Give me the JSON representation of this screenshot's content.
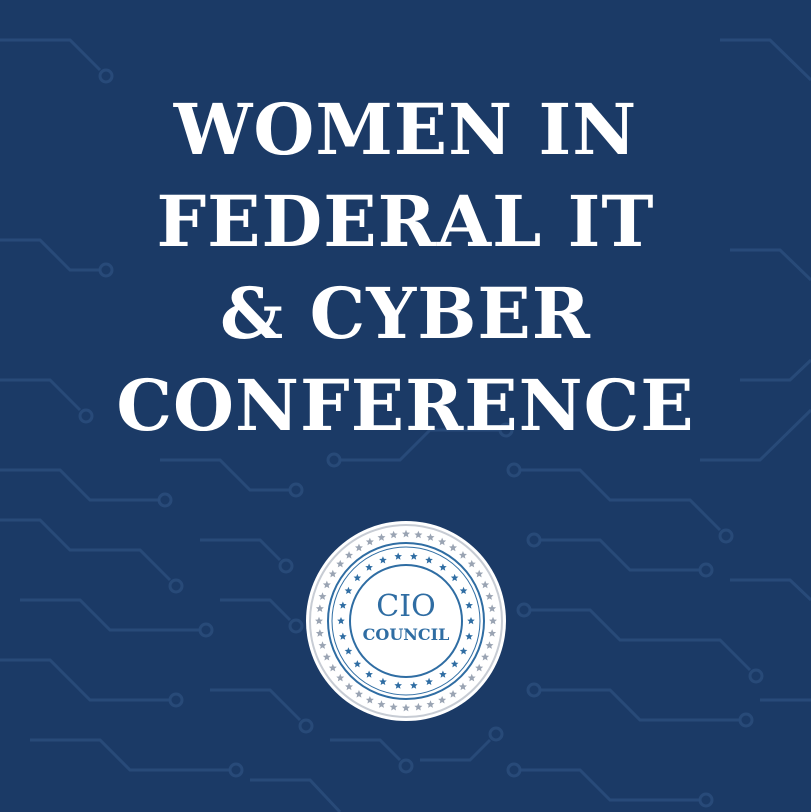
{
  "title_lines": [
    "WOMEN IN",
    "FEDERAL IT",
    "& CYBER",
    "CONFERENCE"
  ],
  "seal": {
    "line1": "CIO",
    "line2": "COUNCIL"
  },
  "colors": {
    "background": "#1b3a66",
    "circuit": "#2a4c7b",
    "title": "#ffffff",
    "seal_face": "#ffffff",
    "seal_accent": "#2f6da3",
    "seal_outer_stars": "#9aa4b3"
  },
  "icons": [
    "circuit-board-pattern",
    "cio-council-seal",
    "star-icon"
  ]
}
